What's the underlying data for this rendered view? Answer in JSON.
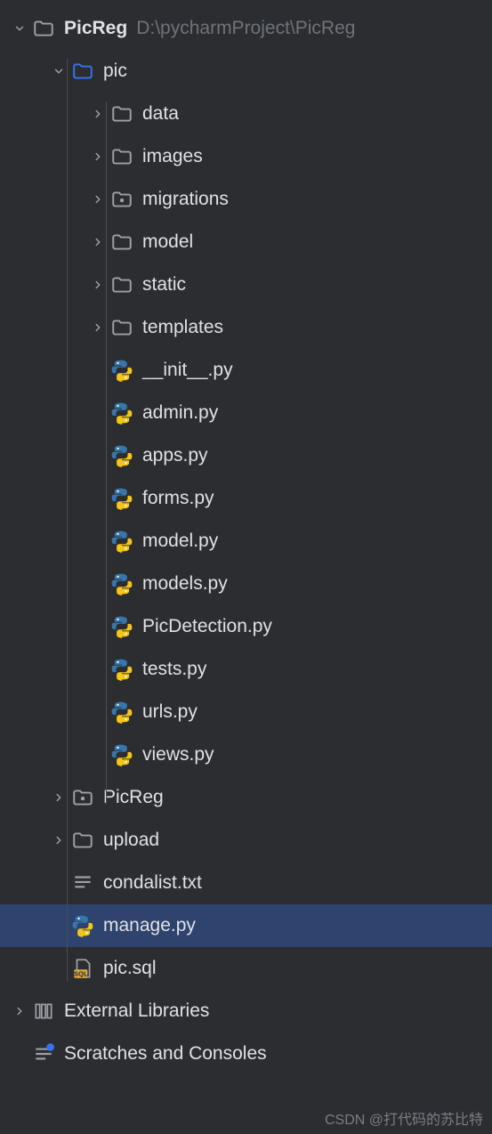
{
  "root": {
    "name": "PicReg",
    "path": "D:\\pycharmProject\\PicReg"
  },
  "pic_folder": {
    "name": "pic"
  },
  "pic_children_folders": [
    {
      "name": "data",
      "icon": "folder"
    },
    {
      "name": "images",
      "icon": "folder"
    },
    {
      "name": "migrations",
      "icon": "folder-dot"
    },
    {
      "name": "model",
      "icon": "folder"
    },
    {
      "name": "static",
      "icon": "folder"
    },
    {
      "name": "templates",
      "icon": "folder"
    }
  ],
  "pic_children_files": [
    {
      "name": "__init__.py"
    },
    {
      "name": "admin.py"
    },
    {
      "name": "apps.py"
    },
    {
      "name": "forms.py"
    },
    {
      "name": "model.py"
    },
    {
      "name": "models.py"
    },
    {
      "name": "PicDetection.py"
    },
    {
      "name": "tests.py"
    },
    {
      "name": "urls.py"
    },
    {
      "name": "views.py"
    }
  ],
  "root_children": [
    {
      "name": "PicReg",
      "icon": "folder-dot",
      "chevron": "right"
    },
    {
      "name": "upload",
      "icon": "folder",
      "chevron": "right"
    },
    {
      "name": "condalist.txt",
      "icon": "text",
      "chevron": "none"
    },
    {
      "name": "manage.py",
      "icon": "python",
      "chevron": "none",
      "selected": true
    },
    {
      "name": "pic.sql",
      "icon": "sql",
      "chevron": "none"
    }
  ],
  "bottom_nodes": [
    {
      "name": "External Libraries",
      "icon": "libraries",
      "chevron": "right"
    },
    {
      "name": "Scratches and Consoles",
      "icon": "scratches",
      "chevron": "none"
    }
  ],
  "watermark": "CSDN @打代码的苏比特"
}
